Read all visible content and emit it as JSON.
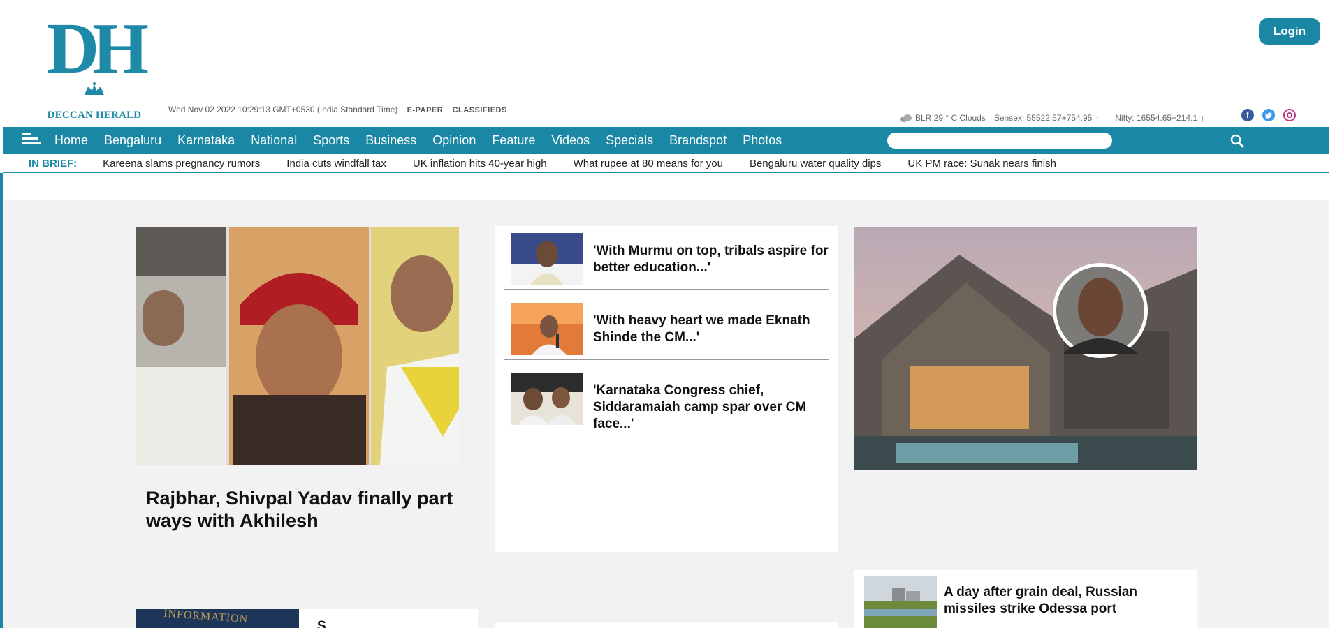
{
  "header": {
    "logo_mark": "DH",
    "logo_name": "DECCAN HERALD",
    "dateline": "Wed Nov 02 2022 10:29:13 GMT+0530 (India Standard Time)",
    "epaper_label": "E-PAPER",
    "classifieds_label": "CLASSIFIEDS",
    "login_label": "Login",
    "weather": "BLR 29 ° C Clouds",
    "sensex": "Sensex: 55522.57+754.95",
    "nifty": "Nifty: 16554.65+214.1",
    "up_arrow": "↑",
    "social_icons": [
      "facebook-icon",
      "twitter-icon",
      "instagram-icon"
    ]
  },
  "nav": {
    "items": [
      "Home",
      "Bengaluru",
      "Karnataka",
      "National",
      "Sports",
      "Business",
      "Opinion",
      "Feature",
      "Videos",
      "Specials",
      "Brandspot",
      "Photos"
    ],
    "search_placeholder": ""
  },
  "brief": {
    "label": "IN BRIEF:",
    "items": [
      "Kareena slams pregnancy rumors",
      "India cuts windfall tax",
      "UK inflation hits 40-year high",
      "What rupee at 80 means for you",
      "Bengaluru water quality dips",
      "UK PM race: Sunak nears finish"
    ]
  },
  "lead": {
    "title": "Rajbhar, Shivpal Yadav finally part ways with Akhilesh"
  },
  "mid_stories": [
    {
      "headline": "'With Murmu on top, tribals aspire for better education...'"
    },
    {
      "headline": "'With heavy heart we made Eknath Shinde the CM...'"
    },
    {
      "headline": "'Karnataka Congress chief, Siddaramaiah camp spar over CM face...'"
    }
  ],
  "right_story": {
    "headline": "A day after grain deal, Russian missiles strike Odessa port"
  },
  "bottom_story": {
    "image_text": "INFORMATION",
    "headline": "S"
  },
  "colors": {
    "brand": "#1a87a4",
    "background": "#f2f2f2",
    "up_arrow": "#2e9a2e"
  }
}
